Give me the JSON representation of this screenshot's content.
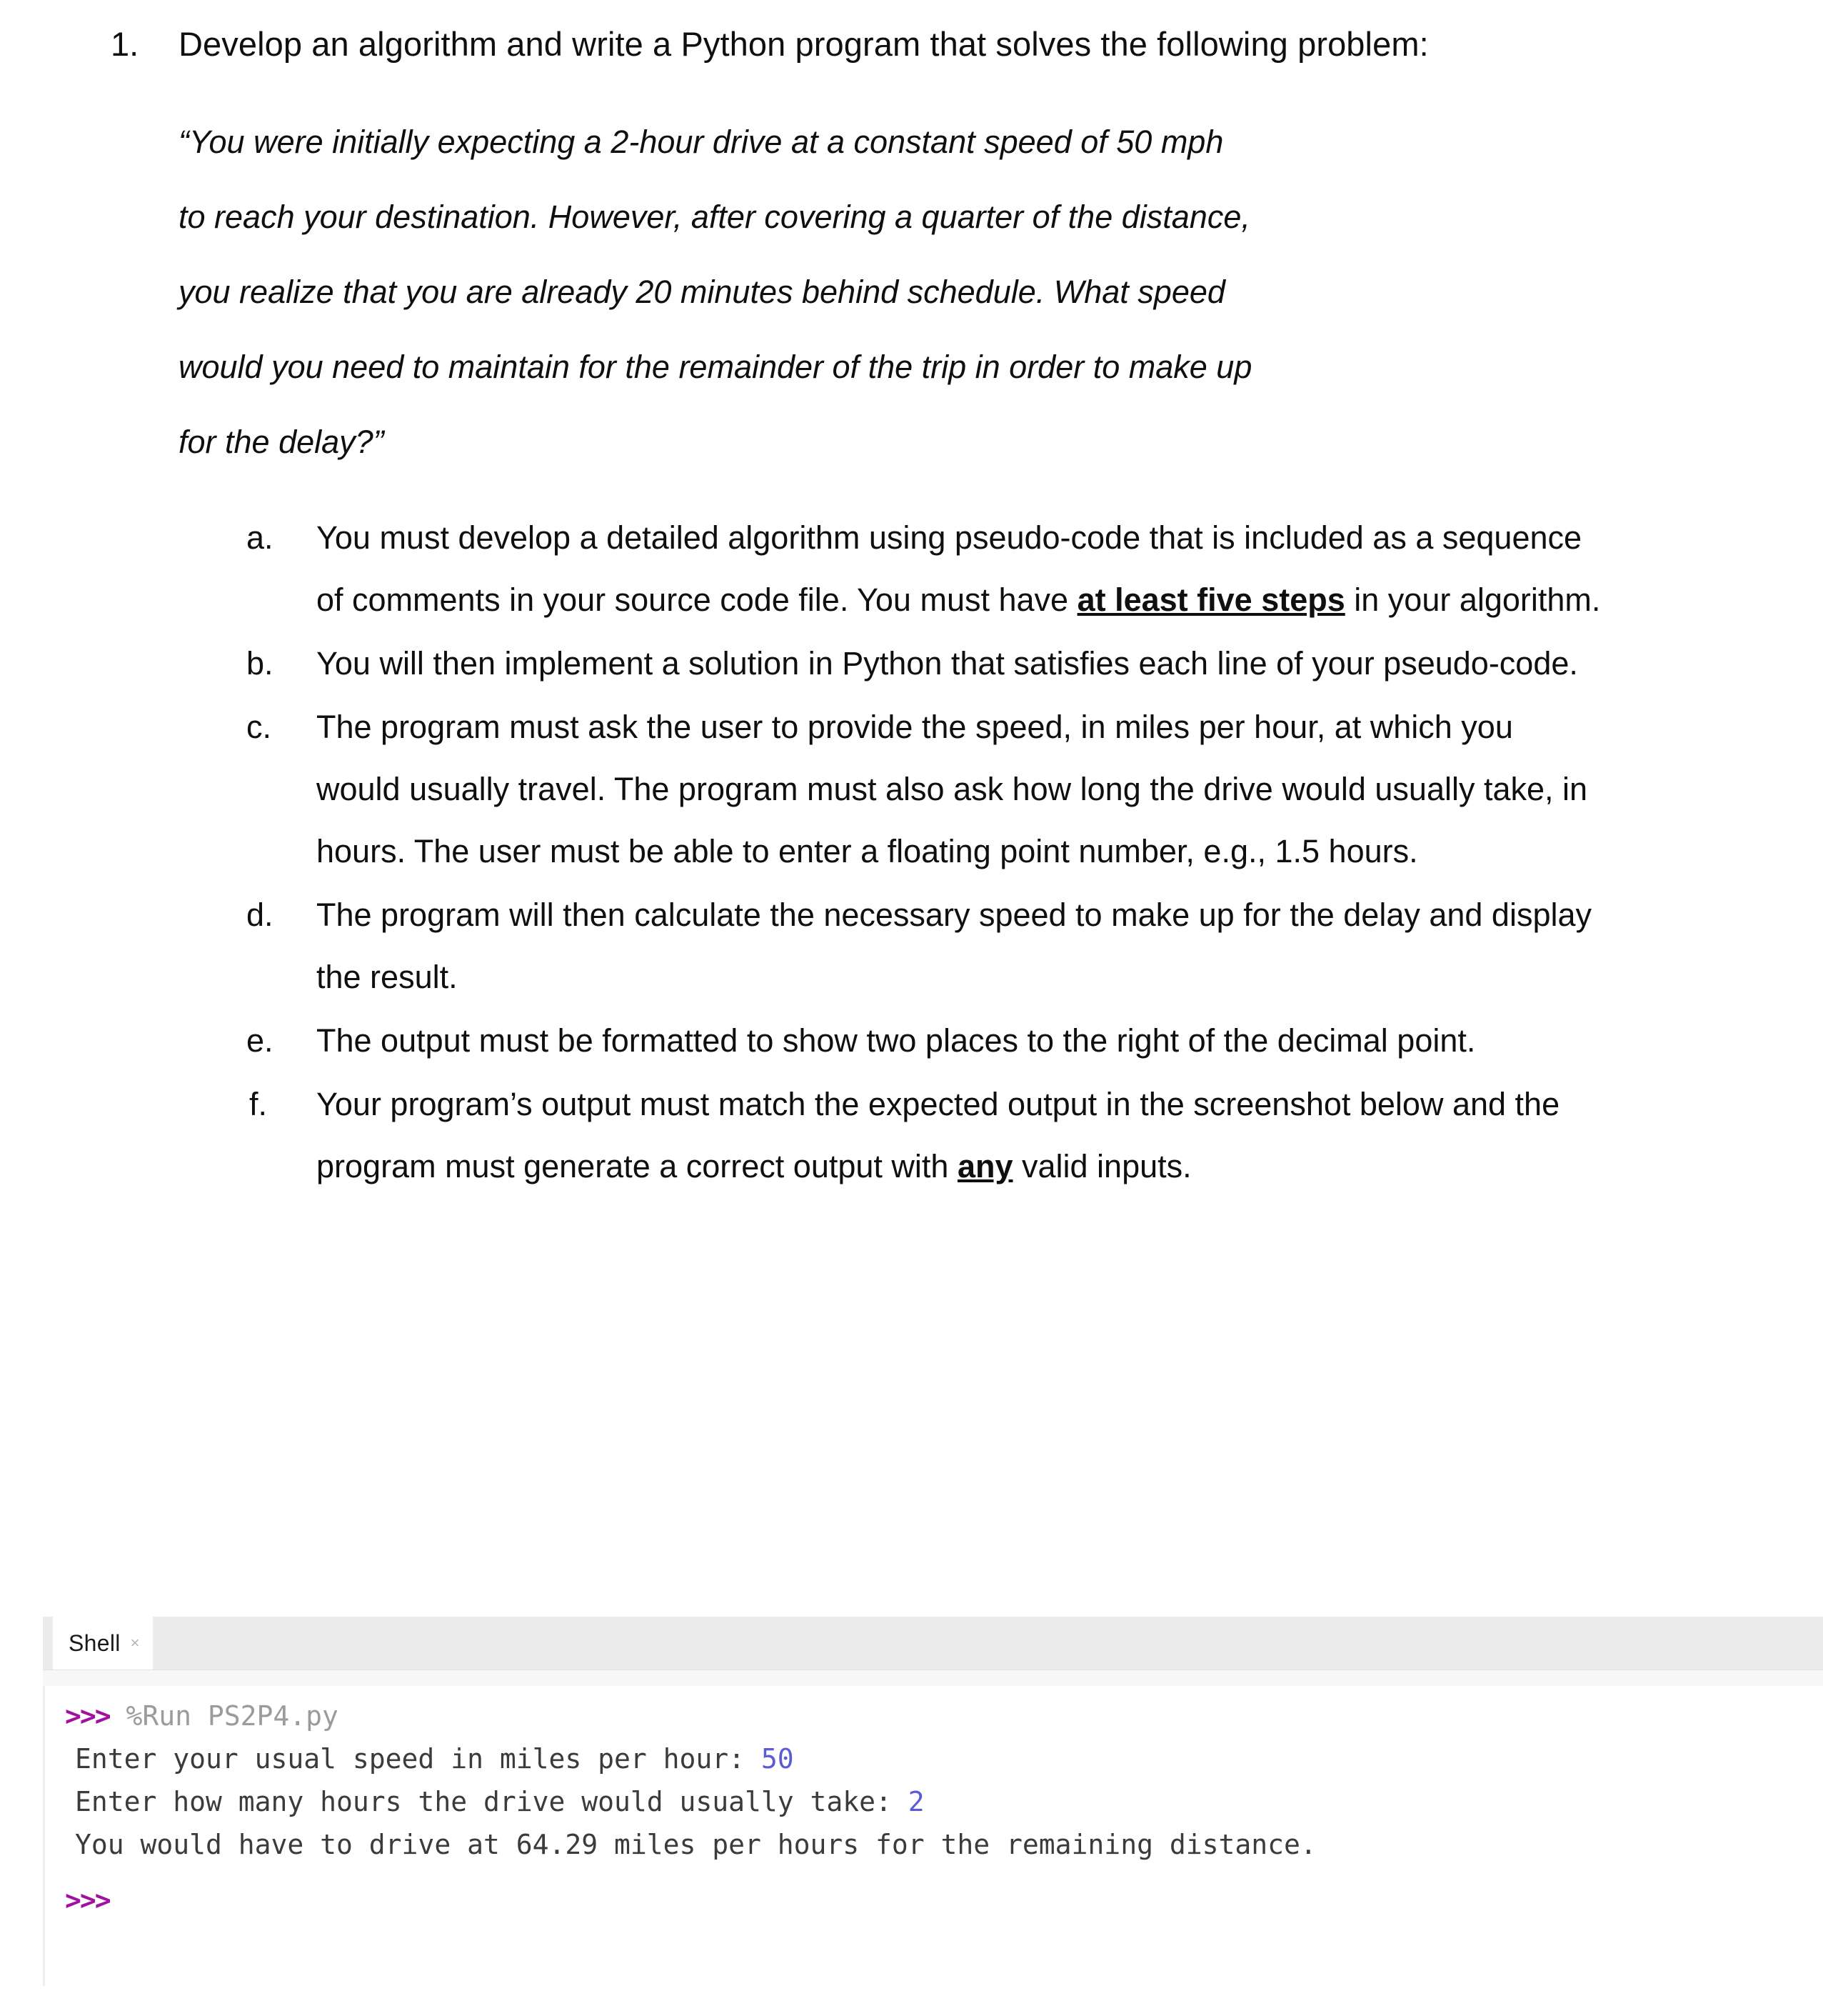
{
  "document": {
    "numbered_item": {
      "marker": "1.",
      "text": "Develop an algorithm and write a Python program that solves the following problem:"
    },
    "quote": {
      "lines": [
        "“You were initially expecting a 2-hour drive at a constant speed of 50 mph",
        "to reach your destination. However, after covering a quarter of the distance,",
        "you realize that you are already 20 minutes behind schedule. What speed",
        "would you need to maintain for the remainder of the trip in order to make up",
        "for the delay?”"
      ]
    },
    "sub_items": [
      {
        "marker": "a.",
        "text_before": "You must develop a detailed algorithm using pseudo-code that is included as a sequence of comments in your source code file. You must have ",
        "emphasis": "at least five steps",
        "text_after": " in your algorithm."
      },
      {
        "marker": "b.",
        "text_before": "You will then implement a solution in Python that satisfies each line of your pseudo-code.",
        "emphasis": "",
        "text_after": ""
      },
      {
        "marker": "c.",
        "text_before": "The program must ask the user to provide the speed, in miles per hour, at which you would usually travel. The program must also ask how long the drive would usually take, in hours. The user must be able to enter a floating point number, e.g., 1.5 hours.",
        "emphasis": "",
        "text_after": ""
      },
      {
        "marker": "d.",
        "text_before": "The program will then calculate the necessary speed to make up for the delay and display the result.",
        "emphasis": "",
        "text_after": ""
      },
      {
        "marker": "e.",
        "text_before": "The output must be formatted to show two places to the right of the decimal point.",
        "emphasis": "",
        "text_after": ""
      },
      {
        "marker": "f.",
        "text_before": "Your program’s output must match the expected output in the screenshot below and the program must generate a correct output with ",
        "emphasis": "any",
        "text_after": " valid inputs."
      }
    ]
  },
  "shell": {
    "tab_label": "Shell",
    "tab_close_glyph": "×",
    "prompt": ">>>",
    "run_command": "%Run PS2P4.py",
    "lines": [
      {
        "text": "Enter your usual speed in miles per hour: ",
        "value": "50"
      },
      {
        "text": "Enter how many hours the drive would usually take: ",
        "value": "2"
      },
      {
        "text": "You would have to drive at 64.29 miles per hours for the remaining distance.",
        "value": ""
      }
    ],
    "final_prompt": ">>>"
  },
  "colors": {
    "prompt_purple": "#a011a0",
    "value_blue": "#5b5bd6",
    "command_gray": "#9b9b9b",
    "shell_text": "#3b3b3b",
    "tabbar_bg": "#ececec"
  }
}
